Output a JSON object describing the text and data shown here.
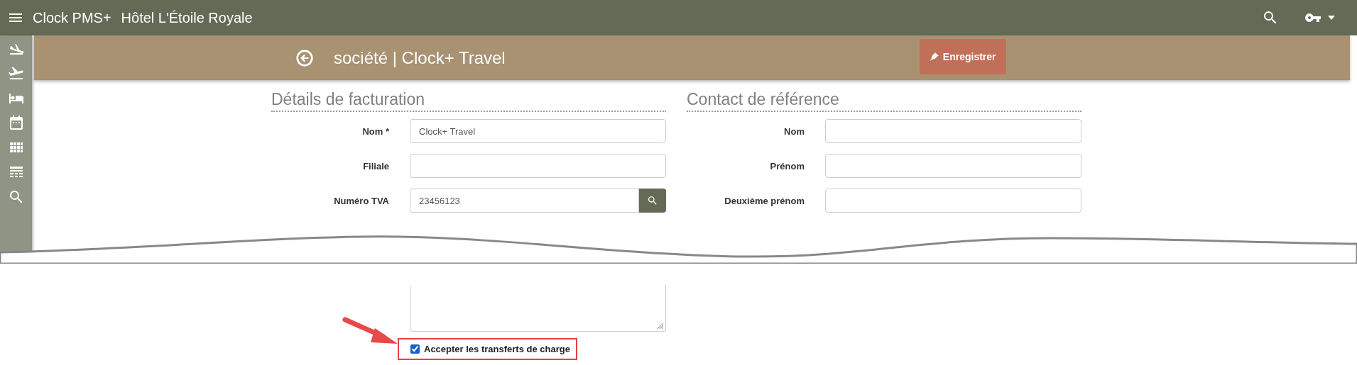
{
  "app_bar": {
    "title": "Clock PMS+",
    "hotel": "Hôtel L'Étoile Royale"
  },
  "header": {
    "title": "société | Clock+ Travel",
    "save_button": "Enregistrer"
  },
  "sections": [
    {
      "heading": "Détails de facturation",
      "fields": [
        {
          "label": "Nom *",
          "value": "Clock+ Travel",
          "kind": "text"
        },
        {
          "label": "Filiale",
          "kind": "text"
        },
        {
          "label": "Numéro TVA",
          "value": "23456123",
          "kind": "search"
        }
      ]
    },
    {
      "heading": "Contact de référence",
      "fields": [
        {
          "label": "Nom",
          "kind": "text"
        },
        {
          "label": "Prénom",
          "kind": "text"
        },
        {
          "label": "Deuxième prénom",
          "kind": "text"
        }
      ]
    }
  ],
  "charge_transfer": {
    "label": "Accepter les transferts de charge",
    "checked": true
  }
}
